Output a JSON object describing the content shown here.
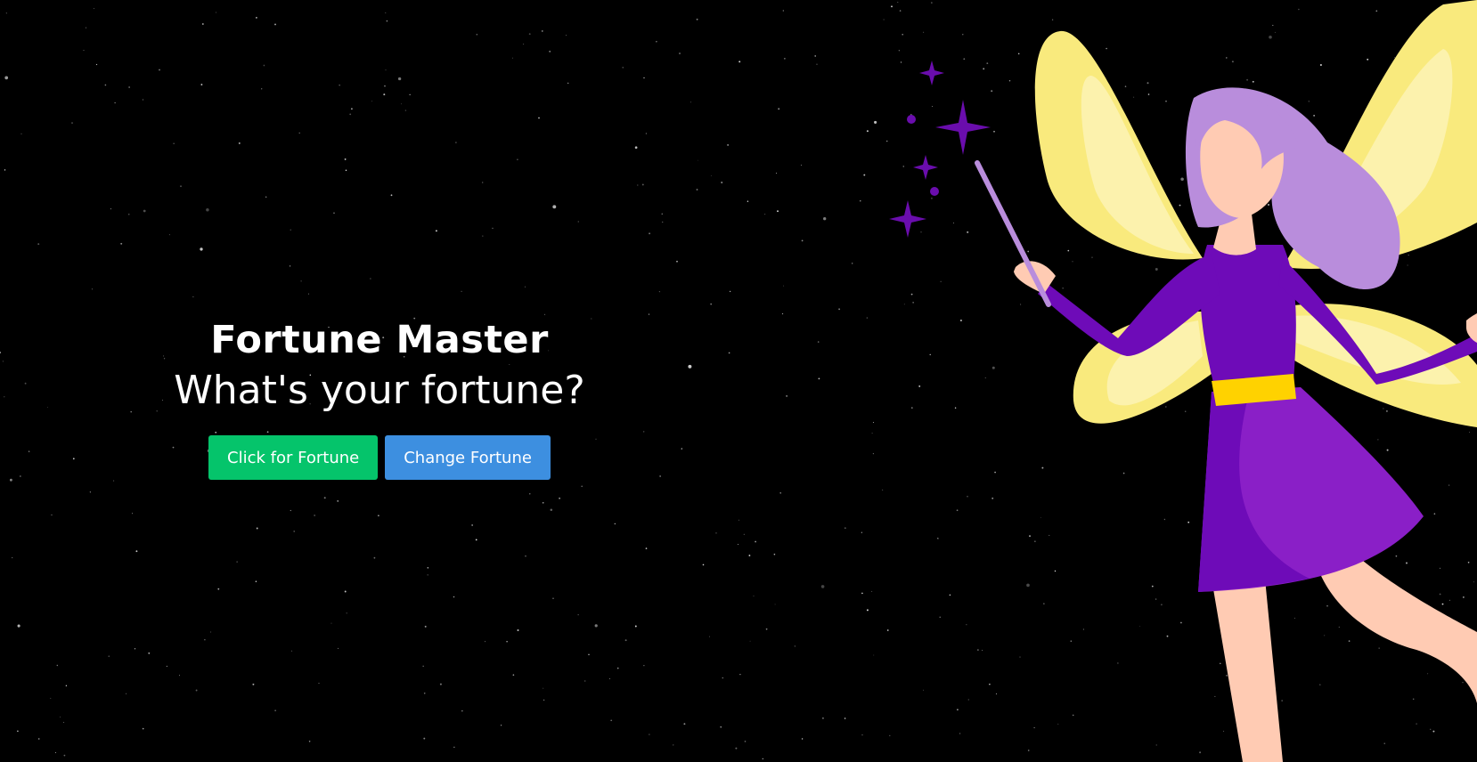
{
  "hero": {
    "title": "Fortune Master",
    "subtitle": "What's your fortune?"
  },
  "buttons": {
    "fortune_label": "Click for Fortune",
    "change_label": "Change Fortune"
  },
  "colors": {
    "background": "#000000",
    "fortune_button": "#05c46b",
    "change_button": "#3d8fe0",
    "wing": "#f9ea7d",
    "dress": "#6e0bb8",
    "hair": "#b98ddc",
    "belt": "#ffd200"
  },
  "icons": {
    "illustration": "fairy-with-wand-illustration",
    "sparkles": "sparkle-icon",
    "background": "starfield"
  }
}
